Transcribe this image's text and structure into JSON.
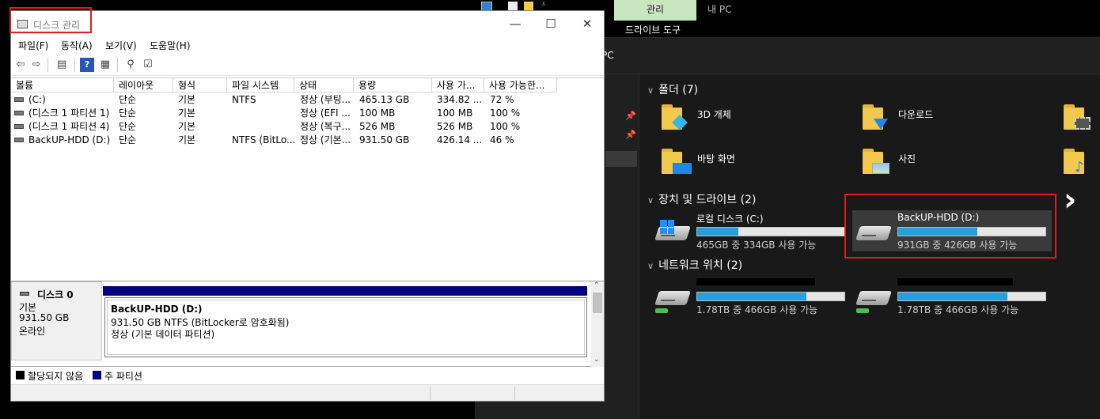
{
  "disk_mgmt": {
    "title": "디스크 관리",
    "controls": {
      "minimize": "—",
      "maximize": "☐",
      "close": "✕"
    },
    "menu": [
      "파일(F)",
      "동작(A)",
      "보기(V)",
      "도움말(H)"
    ],
    "columns": [
      "볼륨",
      "레이아웃",
      "형식",
      "파일 시스템",
      "상태",
      "용량",
      "사용 가...",
      "사용 가능한..."
    ],
    "volumes": [
      [
        "(C:)",
        "단순",
        "기본",
        "NTFS",
        "정상 (부팅...",
        "465.13 GB",
        "334.82 ...",
        "72 %"
      ],
      [
        "(디스크 1 파티션 1)",
        "단순",
        "기본",
        "",
        "정상 (EFI ...",
        "100 MB",
        "100 MB",
        "100 %"
      ],
      [
        "(디스크 1 파티션 4)",
        "단순",
        "기본",
        "",
        "정상 (복구...",
        "526 MB",
        "526 MB",
        "100 %"
      ],
      [
        "BackUP-HDD (D:)",
        "단순",
        "기본",
        "NTFS (BitLo...",
        "정상 (기본...",
        "931.50 GB",
        "426.14 ...",
        "46 %"
      ]
    ],
    "disk": {
      "name": "디스크 0",
      "type": "기본",
      "size": "931.50 GB",
      "status": "온라인"
    },
    "partition": {
      "name": "BackUP-HDD  (D:)",
      "detail": "931.50 GB NTFS (BitLocker로 암호화됨)",
      "state": "정상 (기본 데이터 파티션)"
    },
    "legend": {
      "unallocated": "할당되지 않음",
      "primary": "주 파티션"
    },
    "colors": {
      "primary": "#000080",
      "unallocated": "#000000"
    }
  },
  "explorer": {
    "ribbon_tab_manage": "관리",
    "ribbon_tab_pc": "내 PC",
    "ribbon_drive_tool": "드라이브 도구",
    "address": "PC",
    "folders_title": "폴더 (7)",
    "folders": [
      "3D 개체",
      "다운로드",
      "바탕 화면",
      "사진"
    ],
    "devices_title": "장치 및 드라이브 (2)",
    "drives": [
      {
        "name": "로컬 디스크 (C:)",
        "sub": "465GB 중 334GB 사용 가능",
        "used_fraction": 0.28
      },
      {
        "name": "BackUP-HDD (D:)",
        "sub": "931GB 중 426GB 사용 가능",
        "used_fraction": 0.54
      }
    ],
    "network_title": "네트워크 위치 (2)",
    "network": [
      {
        "sub": "1.78TB 중 466GB 사용 가능",
        "used_fraction": 0.74
      },
      {
        "sub": "1.78TB 중 466GB 사용 가능",
        "used_fraction": 0.74
      }
    ],
    "colors": {
      "bar_fill": "#26a0da",
      "highlight": "#e31b1b",
      "manage_tab": "#c8e6c0"
    }
  }
}
